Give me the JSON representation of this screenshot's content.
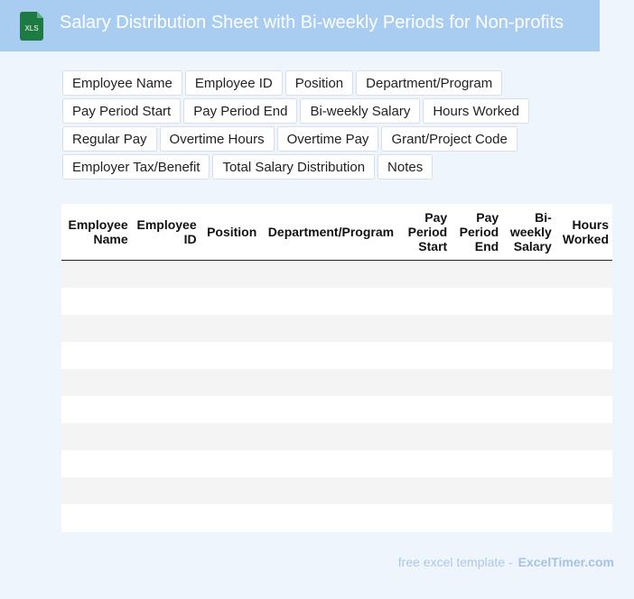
{
  "header": {
    "title": "Salary Distribution Sheet with Bi-weekly Periods for Non-profits",
    "icon_label": "XLS",
    "icon_color": "#1d7a43"
  },
  "tags": [
    "Employee Name",
    "Employee ID",
    "Position",
    "Department/Program",
    "Pay Period Start",
    "Pay Period End",
    "Bi-weekly Salary",
    "Hours Worked",
    "Regular Pay",
    "Overtime Hours",
    "Overtime Pay",
    "Grant/Project Code",
    "Employer Tax/Benefit",
    "Total Salary Distribution",
    "Notes"
  ],
  "table": {
    "columns": [
      [
        "Employee",
        "Name"
      ],
      [
        "Employee",
        "ID"
      ],
      [
        "Position"
      ],
      [
        "Department/Program"
      ],
      [
        "Pay",
        "Period",
        "Start"
      ],
      [
        "Pay",
        "Period",
        "End"
      ],
      [
        "Bi-",
        "weekly",
        "Salary"
      ],
      [
        "Hours",
        "Worked"
      ]
    ]
  },
  "footer": {
    "text": "free excel template -",
    "brand": "ExcelTimer.com"
  }
}
